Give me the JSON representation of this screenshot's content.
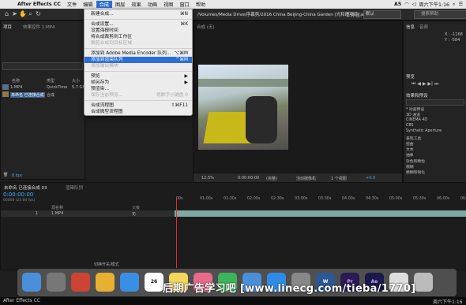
{
  "menubar": {
    "app_name": "After Effects CC",
    "items": [
      "文件",
      "编辑",
      "合成",
      "图层",
      "效果",
      "动画",
      "视图",
      "窗口",
      "帮助"
    ],
    "active_item": "合成",
    "clock": "周六下午1:16",
    "status_icons": [
      "A5"
    ]
  },
  "toolbar": {
    "path": "/Volumes/Media Drive/序幕剪/2016 China Beijing-China Garden (光和眼項目).aep *",
    "workspace_label": "工作区:",
    "workspace_value": "默认",
    "search_help_placeholder": "搜索帮助"
  },
  "project_panel": {
    "tab_label": "项目",
    "effect_tab": "效果控件 1.MP4",
    "headers": [
      "名称",
      "类型",
      "大小"
    ],
    "rows": [
      {
        "name": "1.MP4",
        "type": "QuickTime",
        "size": "5.7 GB"
      },
      {
        "name": "未命名 已连接合成",
        "type": "合成",
        "size": ""
      }
    ],
    "bpc": "8 bpc"
  },
  "viewer": {
    "tab_label": "合成 (无)",
    "zoom": "12.5%",
    "timecode": "0:00:00:00",
    "resolution": "(完整)",
    "camera": "活动摄像机",
    "views": "1 个视图",
    "exposure": "+0.0"
  },
  "info_panel": {
    "tab_label": "信息",
    "audio_tab": "音频",
    "x": "X : -1168",
    "y": "Y : -584",
    "preview_tab": "预览",
    "effects_tab": "效果和预设",
    "effects_search": "",
    "effects_items": [
      "* 动画预设",
      "3D 通道",
      "CINEMA 4D",
      "CBS",
      "Synthetic Aperture",
      "表现工具",
      "扭曲",
      "文本",
      "抽象",
      "杂色和颗粒",
      "模糊",
      "模糊和锐化"
    ]
  },
  "timeline": {
    "comp_tab": "未命名 已连接合成 03",
    "render_tab": "渲染队列",
    "current_time": "0:00:00:00",
    "fps": "00000 (25.00 fps)",
    "layer_name": "1.MP4",
    "layer_number": "1",
    "parent_label": "父级",
    "parent_value": "无",
    "source_col": "源名称",
    "ruler": [
      "00s",
      "01:00s",
      "01:30s",
      "02:00s",
      "02:30s",
      "03:00s",
      "03:30s",
      "04:00s",
      "04:30s",
      "05:00s",
      "05:30s",
      "06:00s",
      "06:30s"
    ],
    "switch_label": "切换开关/模式"
  },
  "dropdown": {
    "items": [
      {
        "label": "新建合成...",
        "shortcut": "⌘N",
        "disabled": false
      },
      {
        "sep": true
      },
      {
        "label": "合成设置...",
        "shortcut": "⌘K",
        "disabled": false
      },
      {
        "label": "设置海报时间",
        "shortcut": "",
        "disabled": false
      },
      {
        "label": "将合成裁剪到工作区",
        "shortcut": "",
        "disabled": false
      },
      {
        "label": "裁剪合成到目标区域",
        "shortcut": "",
        "disabled": true
      },
      {
        "sep": true
      },
      {
        "label": "添加到 Adobe Media Encoder 队列...",
        "shortcut": "⌥⌘M",
        "disabled": false
      },
      {
        "label": "添加到渲染队列",
        "shortcut": "^⌘M",
        "disabled": false,
        "selected": true
      },
      {
        "label": "添加输出模块",
        "shortcut": "",
        "disabled": true
      },
      {
        "sep": true
      },
      {
        "label": "预览",
        "shortcut": "▶",
        "disabled": false
      },
      {
        "label": "帧另存为",
        "shortcut": "▶",
        "disabled": false
      },
      {
        "label": "预渲染...",
        "shortcut": "",
        "disabled": false
      },
      {
        "label": "保存当前预览...",
        "shortcut": "将数字小键盘 0",
        "disabled": true
      },
      {
        "sep": true
      },
      {
        "label": "合成流程图",
        "shortcut": "⇧⌘F11",
        "disabled": false
      },
      {
        "label": "合成微型流程图",
        "shortcut": "",
        "disabled": false
      }
    ]
  },
  "dock": {
    "icons": [
      "finder-icon",
      "launchpad-icon",
      "app-icon",
      "chrome-icon",
      "safari-icon",
      "calendar-icon",
      "notes-icon",
      "photos-icon",
      "facetime-icon",
      "app-icon",
      "appstore-icon",
      "system-preferences-icon",
      "word-icon",
      "premiere-icon",
      "aftereffects-icon",
      "file-icon",
      "trash-icon"
    ],
    "calendar_day": "26",
    "pr_label": "Pr",
    "ae_label": "Ae",
    "w_label": "W"
  },
  "taskbar": {
    "app_name": "After Effects CC",
    "clock": "周六下午1:16"
  },
  "watermark": "后期广告学习吧 [www.linecg.com/tieba/1770]"
}
